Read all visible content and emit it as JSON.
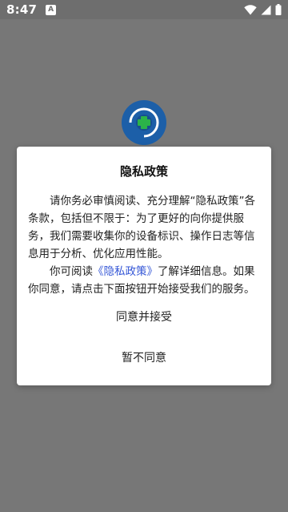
{
  "status_bar": {
    "time": "8:47",
    "notification_icon": "A"
  },
  "dialog": {
    "title": "隐私政策",
    "paragraph1": "请你务必审慎阅读、充分理解“隐私政策”各条款，包括但不限于：为了更好的向你提供服务，我们需要收集你的设备标识、操作日志等信息用于分析、优化应用性能。",
    "paragraph2_prefix": "你可阅读",
    "policy_link": "《隐私政策》",
    "paragraph2_suffix": "了解详细信息。如果你同意，请点击下面按钮开始接受我们的服务。",
    "agree_button": "同意并接受",
    "disagree_button": "暂不同意"
  },
  "colors": {
    "backdrop": "#777777",
    "link": "#3456d6",
    "logo_ring": "#1c5fa8",
    "logo_accent": "#2bb34a"
  }
}
